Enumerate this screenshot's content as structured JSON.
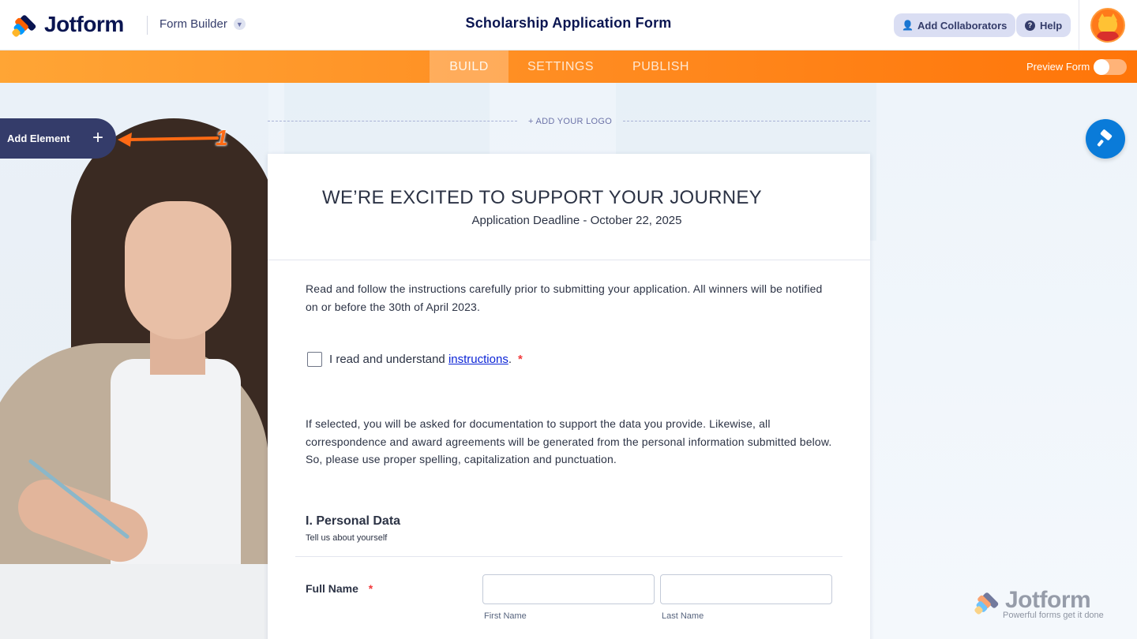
{
  "header": {
    "brand": "Jotform",
    "app_menu": "Form Builder",
    "form_title": "Scholarship Application Form",
    "add_collaborators": "Add Collaborators",
    "help": "Help"
  },
  "nav": {
    "tabs": [
      "BUILD",
      "SETTINGS",
      "PUBLISH"
    ],
    "active_tab": "BUILD",
    "preview_label": "Preview Form",
    "preview_on": false
  },
  "canvas": {
    "add_element_label": "Add Element",
    "annotation_number": "1",
    "add_logo": "+ ADD YOUR LOGO"
  },
  "form": {
    "headline": "WE’RE EXCITED TO SUPPORT YOUR JOURNEY",
    "subheadline": "Application Deadline - October 22, 2025",
    "intro": "Read and follow the instructions carefully prior to submitting your application. All winners will be notified on or before the 30th of April 2023.",
    "checkbox_prefix": "I read and understand ",
    "checkbox_link": "instructions",
    "checkbox_suffix": ".",
    "required_mark": "*",
    "notice": "If selected, you will be asked for documentation to support the data you provide. Likewise, all correspondence and award agreements will be generated from the personal information submitted below. So, please use proper spelling, capitalization and punctuation.",
    "section_title": "I. Personal Data",
    "section_subtitle": "Tell us about yourself",
    "full_name_label": "Full Name",
    "first_name_sublabel": "First Name",
    "last_name_sublabel": "Last Name",
    "first_name_value": "",
    "last_name_value": ""
  },
  "watermark": {
    "brand": "Jotform",
    "tagline": "Powerful forms get it done"
  },
  "colors": {
    "brand_navy": "#0a1551",
    "accent_orange": "#ff7509",
    "designer_blue": "#0a7bd9",
    "required_red": "#f23a3c"
  }
}
